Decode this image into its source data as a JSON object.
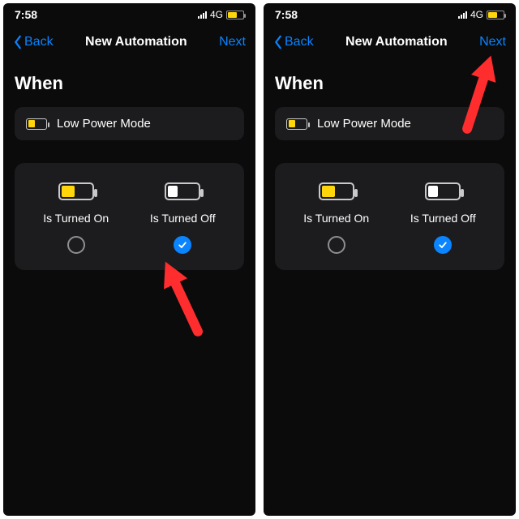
{
  "status": {
    "time": "7:58",
    "net": "4G"
  },
  "nav": {
    "back": "Back",
    "title": "New Automation",
    "next": "Next"
  },
  "when": "When",
  "mode_row": {
    "label": "Low Power Mode"
  },
  "options": {
    "on": {
      "label": "Is Turned On"
    },
    "off": {
      "label": "Is Turned Off"
    }
  },
  "left": {
    "on_selected": false,
    "off_selected": true
  },
  "right": {
    "on_selected": false,
    "off_selected": true
  },
  "colors": {
    "accent": "#0a84ff",
    "lowpower": "#ffd60a",
    "card": "#1c1c1e"
  }
}
